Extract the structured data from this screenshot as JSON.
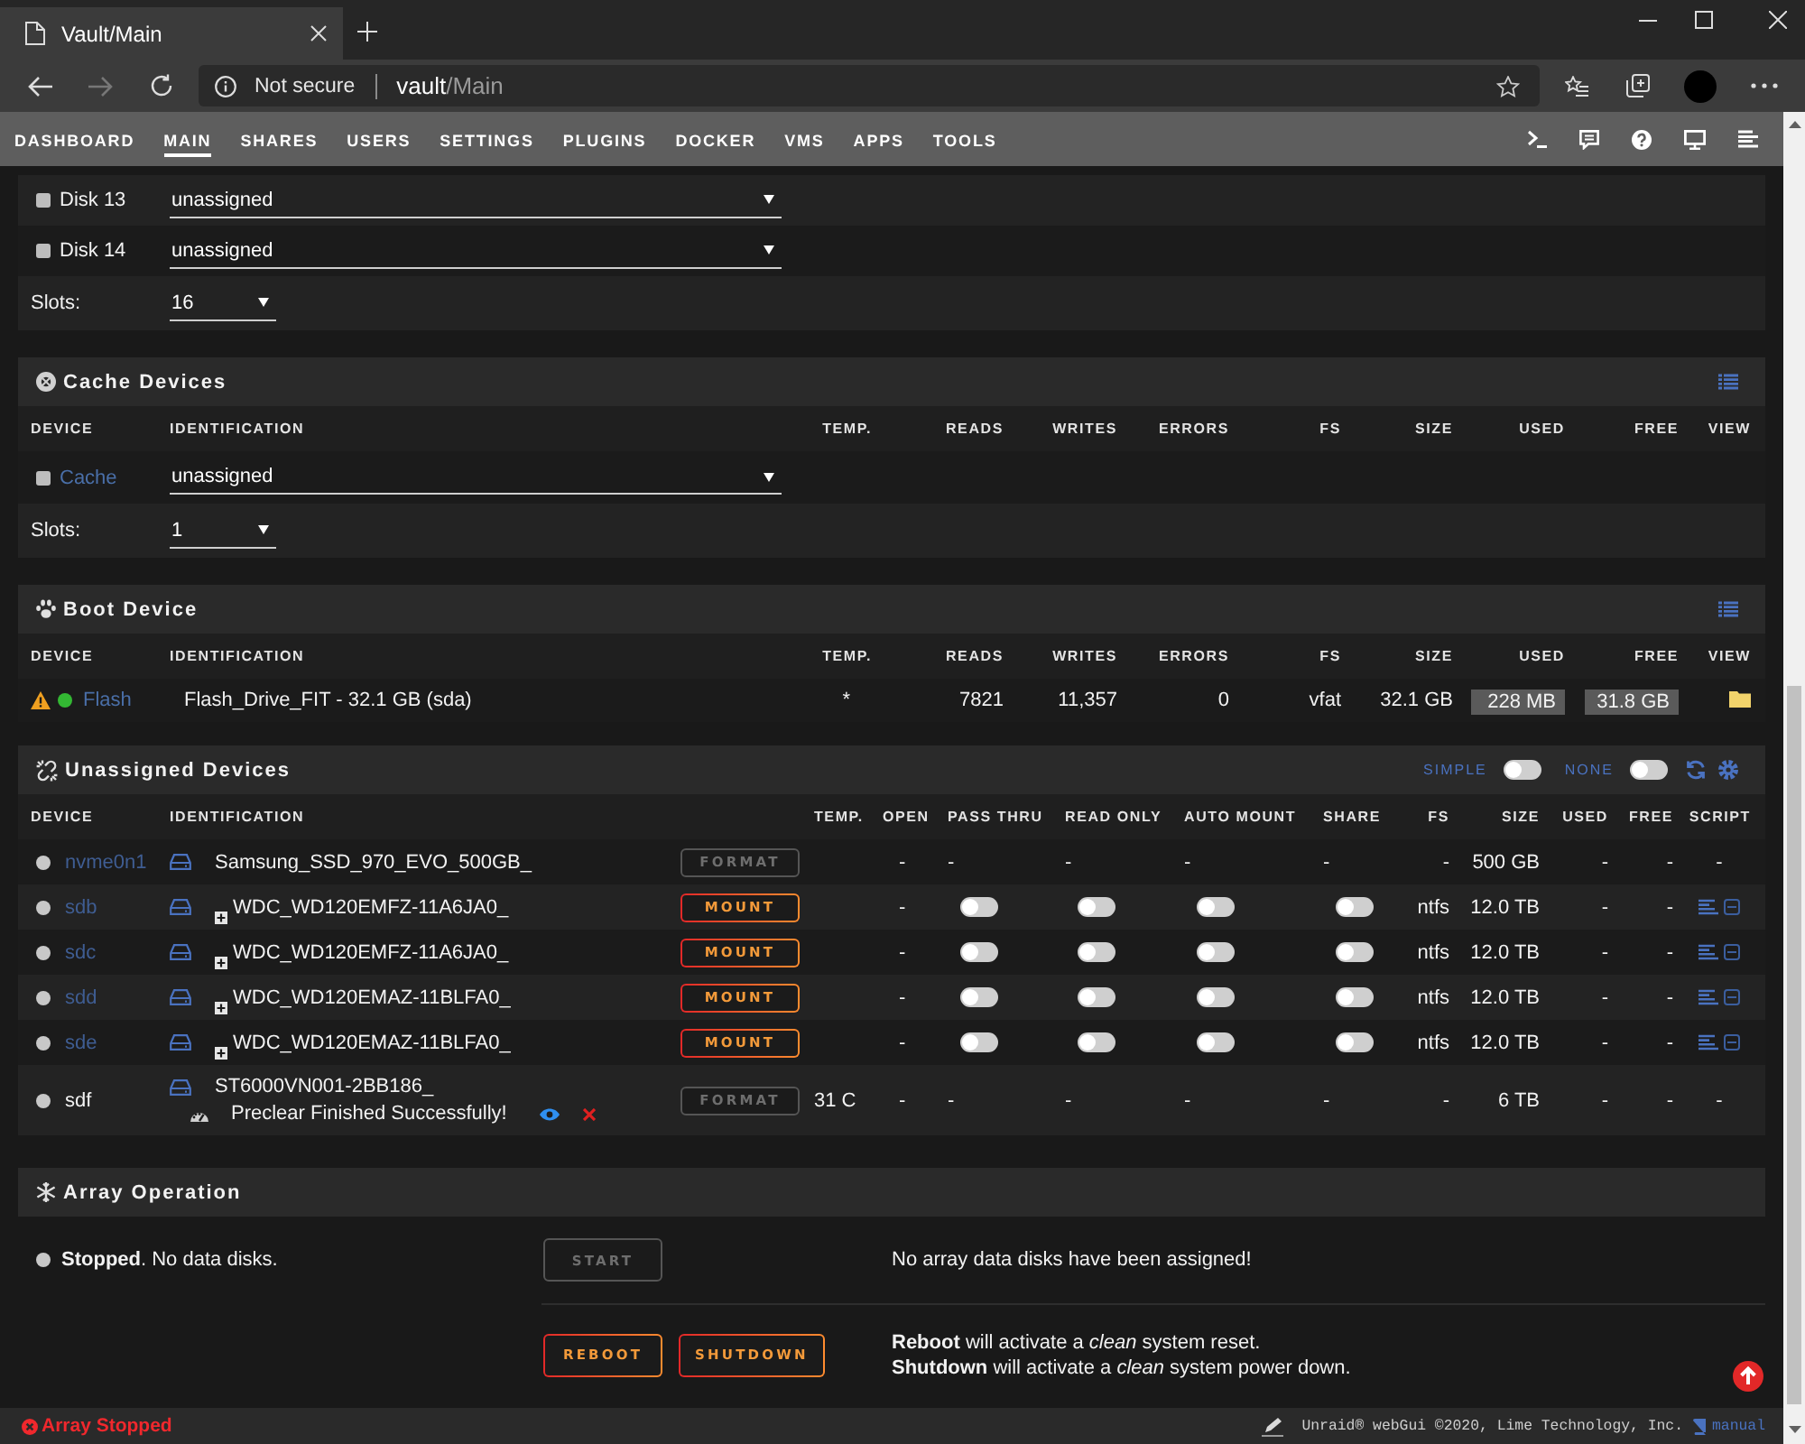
{
  "browser": {
    "tab_title": "Vault/Main",
    "security": "Not secure",
    "url_host": "vault",
    "url_path": "/Main"
  },
  "nav": {
    "items": [
      {
        "label": "DASHBOARD",
        "selected": false
      },
      {
        "label": "MAIN",
        "selected": true
      },
      {
        "label": "SHARES",
        "selected": false
      },
      {
        "label": "USERS",
        "selected": false
      },
      {
        "label": "SETTINGS",
        "selected": false
      },
      {
        "label": "PLUGINS",
        "selected": false
      },
      {
        "label": "DOCKER",
        "selected": false
      },
      {
        "label": "VMS",
        "selected": false
      },
      {
        "label": "APPS",
        "selected": false
      },
      {
        "label": "TOOLS",
        "selected": false
      }
    ]
  },
  "array_devices": {
    "rows": [
      {
        "label": "Disk 13",
        "value": "unassigned"
      },
      {
        "label": "Disk 14",
        "value": "unassigned"
      }
    ],
    "slots": {
      "label": "Slots:",
      "value": "16"
    }
  },
  "cache_devices": {
    "title": "Cache Devices",
    "columns": [
      "DEVICE",
      "IDENTIFICATION",
      "TEMP.",
      "READS",
      "WRITES",
      "ERRORS",
      "FS",
      "SIZE",
      "USED",
      "FREE",
      "VIEW"
    ],
    "rows": [
      {
        "device": "Cache",
        "value": "unassigned"
      }
    ],
    "slots": {
      "label": "Slots:",
      "value": "1"
    }
  },
  "boot_device": {
    "title": "Boot Device",
    "columns": [
      "DEVICE",
      "IDENTIFICATION",
      "TEMP.",
      "READS",
      "WRITES",
      "ERRORS",
      "FS",
      "SIZE",
      "USED",
      "FREE",
      "VIEW"
    ],
    "rows": [
      {
        "warning": true,
        "online": true,
        "device": "Flash",
        "identification": "Flash_Drive_FIT - 32.1 GB (sda)",
        "temp": "*",
        "reads": "7821",
        "writes": "11,357",
        "errors": "0",
        "fs": "vfat",
        "size": "32.1 GB",
        "used": "228 MB",
        "free": "31.8 GB"
      }
    ]
  },
  "unassigned_devices": {
    "title": "Unassigned Devices",
    "toggles": [
      {
        "label": "SIMPLE",
        "on": false
      },
      {
        "label": "NONE",
        "on": false
      }
    ],
    "columns": [
      "DEVICE",
      "IDENTIFICATION",
      "TEMP.",
      "OPEN",
      "PASS THRU",
      "READ ONLY",
      "AUTO MOUNT",
      "SHARE",
      "FS",
      "SIZE",
      "USED",
      "FREE",
      "SCRIPT"
    ],
    "rows": [
      {
        "online": false,
        "device": "nvme0n1",
        "link": true,
        "partitions": false,
        "identification": "Samsung_SSD_970_EVO_500GB_",
        "action": {
          "label": "FORMAT",
          "disabled": true
        },
        "open": "-",
        "options": [
          {
            "kind": "text",
            "text": "-"
          },
          {
            "kind": "text",
            "text": "-"
          },
          {
            "kind": "text",
            "text": "-"
          },
          {
            "kind": "text",
            "text": "-"
          }
        ],
        "fs": "-",
        "size": "500 GB",
        "used": "-",
        "free": "-",
        "script": {
          "kind": "text",
          "text": "-"
        }
      },
      {
        "online": false,
        "device": "sdb",
        "link": true,
        "partitions": true,
        "identification": "WDC_WD120EMFZ-11A6JA0_",
        "action": {
          "label": "MOUNT",
          "disabled": false
        },
        "open": "-",
        "options": [
          {
            "kind": "toggle",
            "on": false
          },
          {
            "kind": "toggle",
            "on": false
          },
          {
            "kind": "toggle",
            "on": false
          },
          {
            "kind": "toggle",
            "on": false
          }
        ],
        "fs": "ntfs",
        "size": "12.0 TB",
        "used": "-",
        "free": "-",
        "script": {
          "kind": "icons"
        }
      },
      {
        "online": false,
        "device": "sdc",
        "link": true,
        "partitions": true,
        "identification": "WDC_WD120EMFZ-11A6JA0_",
        "action": {
          "label": "MOUNT",
          "disabled": false
        },
        "open": "-",
        "options": [
          {
            "kind": "toggle",
            "on": false
          },
          {
            "kind": "toggle",
            "on": false
          },
          {
            "kind": "toggle",
            "on": false
          },
          {
            "kind": "toggle",
            "on": false
          }
        ],
        "fs": "ntfs",
        "size": "12.0 TB",
        "used": "-",
        "free": "-",
        "script": {
          "kind": "icons"
        }
      },
      {
        "online": false,
        "device": "sdd",
        "link": true,
        "partitions": true,
        "identification": "WDC_WD120EMAZ-11BLFA0_",
        "action": {
          "label": "MOUNT",
          "disabled": false
        },
        "open": "-",
        "options": [
          {
            "kind": "toggle",
            "on": false
          },
          {
            "kind": "toggle",
            "on": false
          },
          {
            "kind": "toggle",
            "on": false
          },
          {
            "kind": "toggle",
            "on": false
          }
        ],
        "fs": "ntfs",
        "size": "12.0 TB",
        "used": "-",
        "free": "-",
        "script": {
          "kind": "icons"
        }
      },
      {
        "online": false,
        "device": "sde",
        "link": true,
        "partitions": true,
        "identification": "WDC_WD120EMAZ-11BLFA0_",
        "action": {
          "label": "MOUNT",
          "disabled": false
        },
        "open": "-",
        "options": [
          {
            "kind": "toggle",
            "on": false
          },
          {
            "kind": "toggle",
            "on": false
          },
          {
            "kind": "toggle",
            "on": false
          },
          {
            "kind": "toggle",
            "on": false
          }
        ],
        "fs": "ntfs",
        "size": "12.0 TB",
        "used": "-",
        "free": "-",
        "script": {
          "kind": "icons"
        }
      },
      {
        "online": false,
        "device": "sdf",
        "link": false,
        "partitions": false,
        "identification": "ST6000VN001-2BB186_",
        "preclear": "Preclear Finished Successfully!",
        "action": {
          "label": "FORMAT",
          "disabled": true
        },
        "temp": "31 C",
        "open": "-",
        "options": [
          {
            "kind": "text",
            "text": "-"
          },
          {
            "kind": "text",
            "text": "-"
          },
          {
            "kind": "text",
            "text": "-"
          },
          {
            "kind": "text",
            "text": "-"
          }
        ],
        "fs": "-",
        "size": "6 TB",
        "used": "-",
        "free": "-",
        "script": {
          "kind": "text",
          "text": "-"
        }
      }
    ]
  },
  "array_operation": {
    "title": "Array Operation",
    "status": "**Stopped**. No data disks.",
    "start": {
      "label": "START",
      "disabled": true
    },
    "start_message": "No array data disks have been assigned!",
    "buttons": [
      "REBOOT",
      "SHUTDOWN"
    ],
    "notes": [
      "**Reboot** will activate a *clean* system reset.",
      "**Shutdown** will activate a *clean* system power down."
    ]
  },
  "footer": {
    "status": "Array Stopped",
    "credits": "Unraid® webGui ©2020, Lime Technology, Inc.",
    "manual": "manual"
  }
}
